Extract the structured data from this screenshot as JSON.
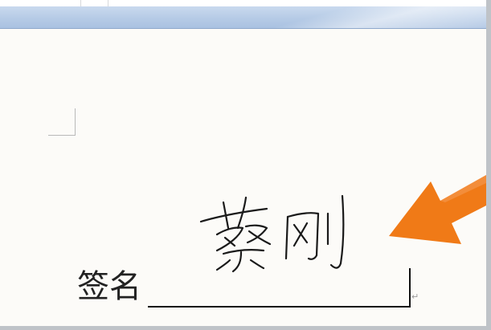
{
  "document": {
    "signature_label": "签名",
    "handwritten_signature": "蔡刚",
    "paragraph_mark": "↵"
  },
  "colors": {
    "ribbon": "#b6cbe6",
    "page": "#fcfbf8",
    "arrow": "#f07a17",
    "ink": "#1a1a1a"
  },
  "icons": {
    "arrow": "arrow-pointer-icon"
  }
}
